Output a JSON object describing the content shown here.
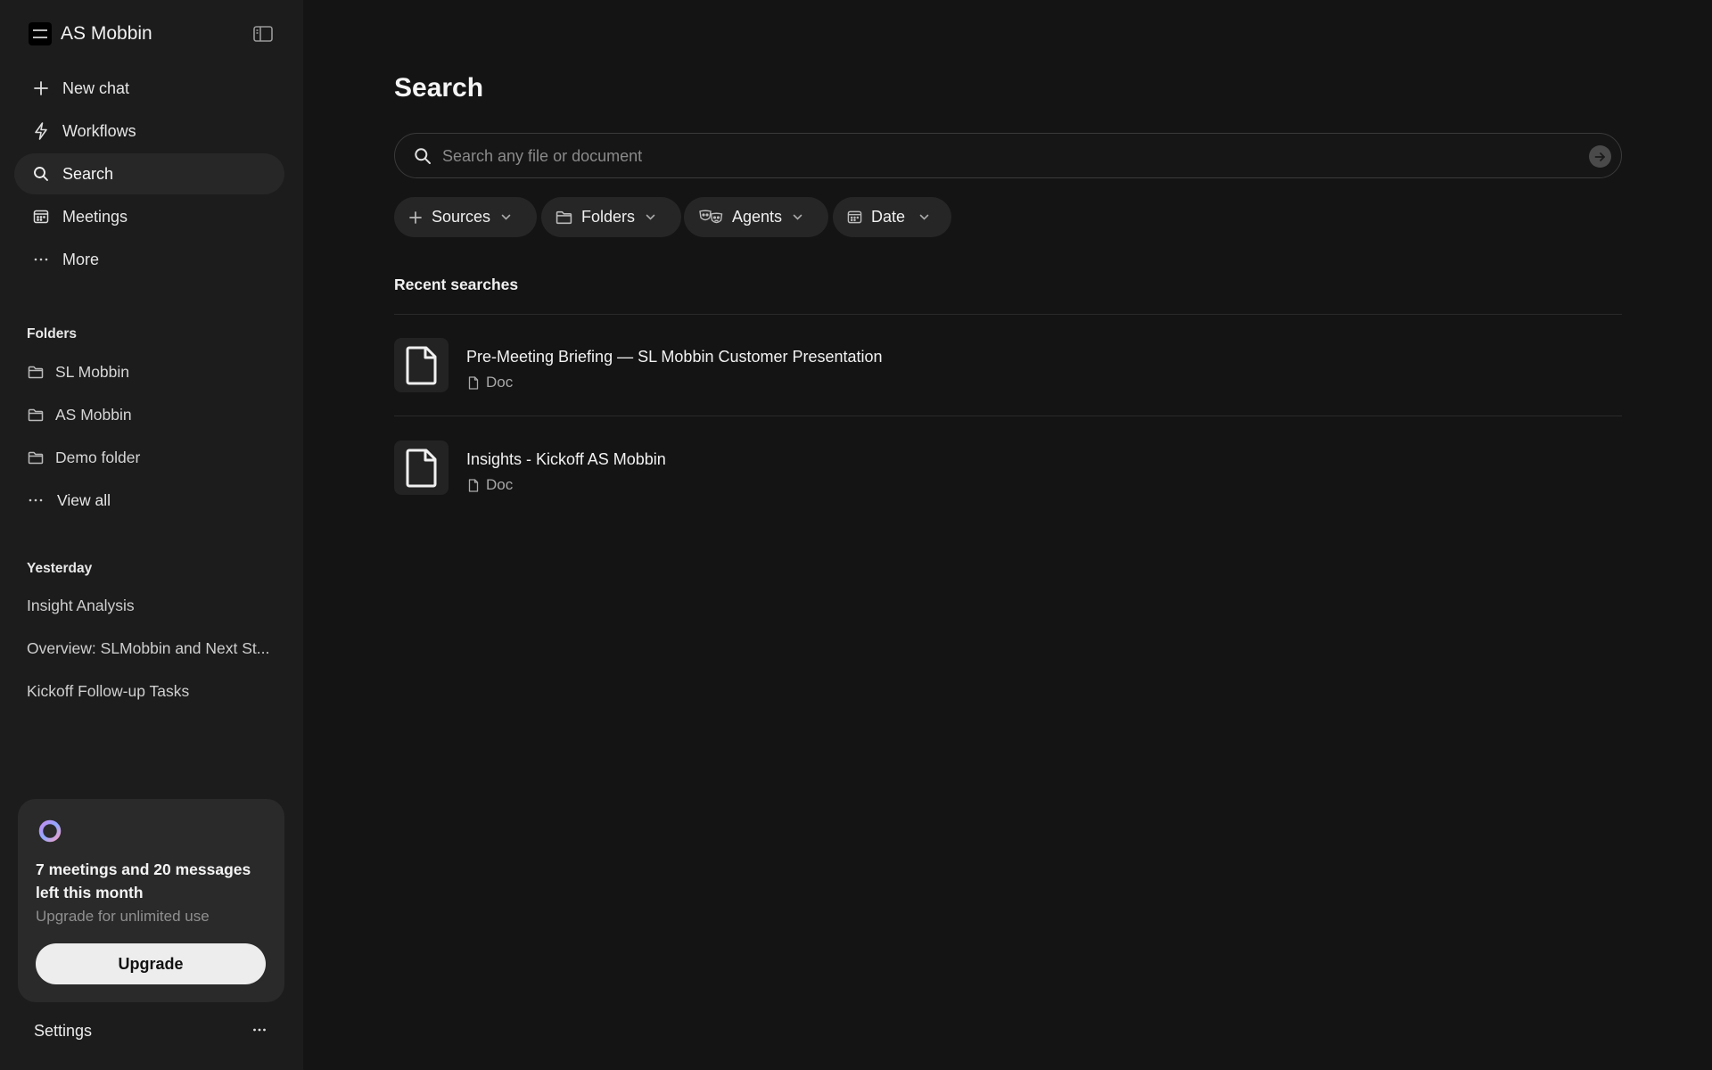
{
  "workspace": {
    "name": "AS Mobbin"
  },
  "nav": [
    {
      "label": "New chat",
      "icon": "plus-icon"
    },
    {
      "label": "Workflows",
      "icon": "lightning-icon"
    },
    {
      "label": "Search",
      "icon": "search-icon",
      "active": true
    },
    {
      "label": "Meetings",
      "icon": "calendar-icon"
    },
    {
      "label": "More",
      "icon": "more-dots-icon"
    }
  ],
  "folders": {
    "heading": "Folders",
    "items": [
      {
        "label": "SL Mobbin",
        "icon": "folder-icon"
      },
      {
        "label": "AS Mobbin",
        "icon": "folder-icon"
      },
      {
        "label": "Demo folder",
        "icon": "folder-icon"
      }
    ],
    "view_all": "View all"
  },
  "history": {
    "heading": "Yesterday",
    "items": [
      "Insight Analysis",
      "Overview: SLMobbin and Next St...",
      "Kickoff Follow-up Tasks"
    ]
  },
  "usage": {
    "title": "7 meetings and 20 messages left this month",
    "subtitle": "Upgrade for unlimited use",
    "button": "Upgrade",
    "ring_colors": [
      "#c58cf0",
      "#8fa8ff",
      "#f0a0c8"
    ]
  },
  "settings": {
    "label": "Settings"
  },
  "main": {
    "title": "Search",
    "search": {
      "placeholder": "Search any file or document",
      "value": ""
    },
    "filters": [
      {
        "label": "Sources",
        "icon": "plus-icon"
      },
      {
        "label": "Folders",
        "icon": "folder-icon"
      },
      {
        "label": "Agents",
        "icon": "masks-icon"
      },
      {
        "label": "Date",
        "icon": "calendar-icon"
      }
    ],
    "recent_heading": "Recent searches",
    "results": [
      {
        "title": "Pre-Meeting Briefing — SL Mobbin Customer Presentation",
        "type": "Doc"
      },
      {
        "title": "Insights - Kickoff AS Mobbin",
        "type": "Doc"
      }
    ]
  }
}
